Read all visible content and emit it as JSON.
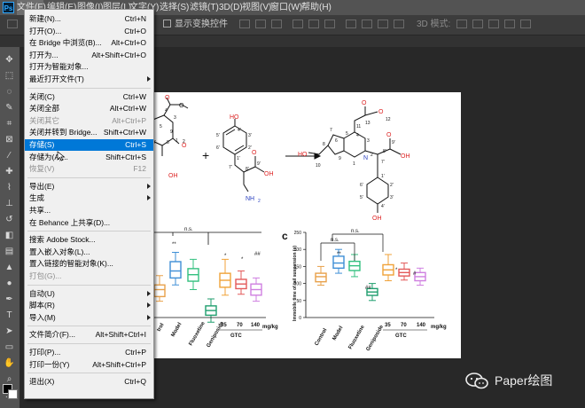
{
  "app": {
    "logo": "Ps"
  },
  "menubar": {
    "items": [
      "文件(F)",
      "编辑(E)",
      "图像(I)",
      "图层(L)",
      "文字(Y)",
      "选择(S)",
      "滤镜(T)",
      "3D(D)",
      "视图(V)",
      "窗口(W)",
      "帮助(H)"
    ],
    "active_index": 0
  },
  "options_bar": {
    "show_transform_controls": "显示变换控件",
    "mode_3d": "3D 模式:"
  },
  "file_menu": {
    "groups": [
      [
        {
          "label": "新建(N)...",
          "shortcut": "Ctrl+N"
        },
        {
          "label": "打开(O)...",
          "shortcut": "Ctrl+O"
        },
        {
          "label": "在 Bridge 中浏览(B)...",
          "shortcut": "Alt+Ctrl+O"
        },
        {
          "label": "打开为...",
          "shortcut": "Alt+Shift+Ctrl+O"
        },
        {
          "label": "打开为智能对象...",
          "shortcut": ""
        },
        {
          "label": "最近打开文件(T)",
          "shortcut": "",
          "submenu": true
        }
      ],
      [
        {
          "label": "关闭(C)",
          "shortcut": "Ctrl+W"
        },
        {
          "label": "关闭全部",
          "shortcut": "Alt+Ctrl+W"
        },
        {
          "label": "关闭其它",
          "shortcut": "Alt+Ctrl+P",
          "disabled": true
        },
        {
          "label": "关闭并转到 Bridge...",
          "shortcut": "Shift+Ctrl+W"
        },
        {
          "label": "存储(S)",
          "shortcut": "Ctrl+S",
          "highlighted": true
        },
        {
          "label": "存储为(A)...",
          "shortcut": "Shift+Ctrl+S"
        },
        {
          "label": "恢复(V)",
          "shortcut": "F12",
          "disabled": true
        }
      ],
      [
        {
          "label": "导出(E)",
          "shortcut": "",
          "submenu": true
        },
        {
          "label": "生成",
          "shortcut": "",
          "submenu": true
        },
        {
          "label": "共享...",
          "shortcut": ""
        },
        {
          "label": "在 Behance 上共享(D)...",
          "shortcut": ""
        }
      ],
      [
        {
          "label": "搜索 Adobe Stock...",
          "shortcut": ""
        },
        {
          "label": "置入嵌入对象(L)...",
          "shortcut": ""
        },
        {
          "label": "置入链接的智能对象(K)...",
          "shortcut": ""
        },
        {
          "label": "打包(G)...",
          "shortcut": "",
          "disabled": true
        }
      ],
      [
        {
          "label": "自动(U)",
          "shortcut": "",
          "submenu": true
        },
        {
          "label": "脚本(R)",
          "shortcut": "",
          "submenu": true
        },
        {
          "label": "导入(M)",
          "shortcut": "",
          "submenu": true
        }
      ],
      [
        {
          "label": "文件简介(F)...",
          "shortcut": "Alt+Shift+Ctrl+I"
        }
      ],
      [
        {
          "label": "打印(P)...",
          "shortcut": "Ctrl+P"
        },
        {
          "label": "打印一份(Y)",
          "shortcut": "Alt+Shift+Ctrl+P"
        }
      ],
      [
        {
          "label": "退出(X)",
          "shortcut": "Ctrl+Q"
        }
      ]
    ]
  },
  "document": {
    "molecule_a": [
      "O",
      "O",
      "H",
      "O",
      "1",
      "2",
      "3",
      "4",
      "5",
      "6",
      "7",
      "8",
      "9",
      "10",
      "11",
      "OH"
    ],
    "molecule_b": [
      "HO",
      "4'",
      "5'",
      "3'",
      "6'",
      "2'",
      "1'",
      "7'",
      "8'",
      "9'",
      "NH",
      "2",
      "O",
      "OH"
    ],
    "product": [
      "O",
      "O",
      "12",
      "13",
      "10",
      "11",
      "7",
      "6",
      "5",
      "4",
      "3",
      "8",
      "9",
      "HO",
      "1",
      "N",
      "2",
      "7'",
      "8'",
      "9'",
      "OH",
      "O",
      "1'",
      "2'",
      "6'",
      "3'",
      "5'",
      "4'",
      "OH"
    ],
    "plus": "+",
    "chart_left_labels": {
      "categories": [
        "Control",
        "Model",
        "Fluoxetine",
        "Geniposide",
        "35",
        "70",
        "140"
      ],
      "visible_categories": [
        "trol",
        "Model",
        "Fluoxetine",
        "Geniposide",
        "35",
        "70",
        "140"
      ],
      "group": "GTC",
      "unit": "mg/kg",
      "sig_ns": "n.s.",
      "stars": [
        "**",
        "*",
        "*",
        "##"
      ]
    },
    "chart_c": {
      "panel_label": "c",
      "ylabel": "Immobile time of tail suspension (s)",
      "yticks": [
        "0",
        "50",
        "100",
        "150",
        "200",
        "250"
      ],
      "categories": [
        "Control",
        "Model",
        "Fluoxetine",
        "Geniposide",
        "35",
        "70",
        "140"
      ],
      "group": "GTC",
      "unit": "mg/kg",
      "sig_ns_1": "n.s.",
      "sig_ns_2": "n.s.",
      "stars": [
        "**",
        "##",
        "*",
        "#"
      ]
    }
  },
  "watermark": {
    "text": "Paper绘图"
  },
  "chart_data": [
    {
      "type": "box",
      "title": "",
      "xlabel": "",
      "ylabel": "",
      "categories": [
        "Control",
        "Model",
        "Fluoxetine",
        "Geniposide",
        "35",
        "70",
        "140"
      ],
      "note": "partially hidden by menu",
      "colors": [
        "#e8a14a",
        "#3f8fd6",
        "#33c07f",
        "#1f9e6e",
        "#f0a238",
        "#e35a5a",
        "#cf7fe0"
      ]
    },
    {
      "type": "box",
      "title": "",
      "xlabel": "",
      "ylabel": "Immobile time of tail suspension (s)",
      "ylim": [
        0,
        250
      ],
      "categories": [
        "Control",
        "Model",
        "Fluoxetine",
        "Geniposide",
        "35",
        "70",
        "140"
      ],
      "series": [
        {
          "values_median": [
            120,
            160,
            152,
            75,
            140,
            132,
            120
          ],
          "q1": [
            105,
            145,
            138,
            65,
            125,
            122,
            108
          ],
          "q3": [
            130,
            180,
            165,
            85,
            155,
            142,
            132
          ],
          "min": [
            95,
            130,
            120,
            50,
            108,
            110,
            95
          ],
          "max": [
            150,
            200,
            185,
            100,
            185,
            160,
            145
          ]
        }
      ],
      "colors": [
        "#e8a14a",
        "#3f8fd6",
        "#33c07f",
        "#1f9e6e",
        "#f0a238",
        "#e35a5a",
        "#cf7fe0"
      ]
    }
  ]
}
